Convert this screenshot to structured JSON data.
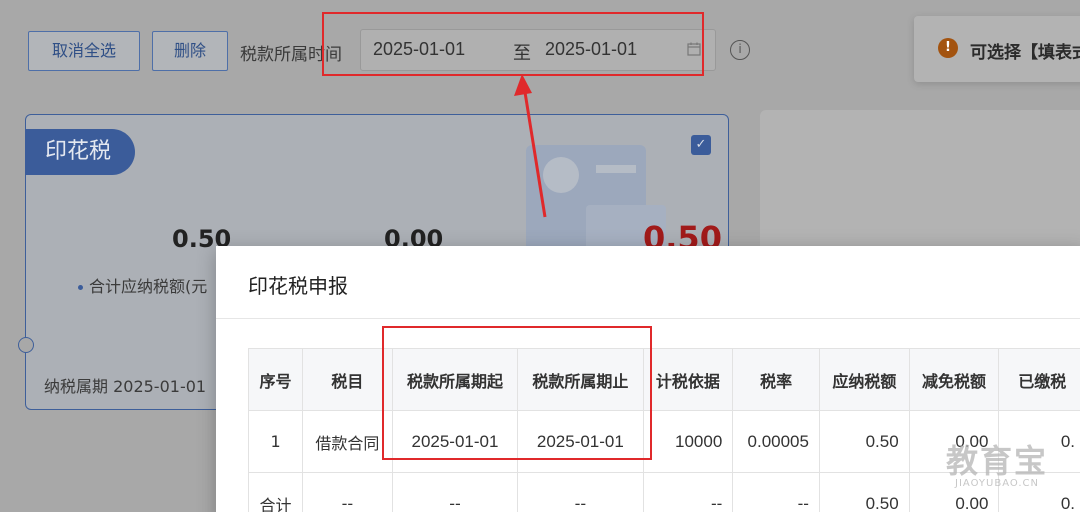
{
  "toolbar": {
    "cancel_select_label": "取消全选",
    "delete_label": "删除",
    "period_label": "税款所属时间",
    "date_start": "2025-01-01",
    "date_sep": "至",
    "date_end": "2025-01-01",
    "info_icon": "i"
  },
  "notice": {
    "icon": "!",
    "text": "可选择【填表式"
  },
  "card": {
    "tag": "印花税",
    "checked": "✓",
    "value1": "0.50",
    "value2": "0.00",
    "value3": "0.50",
    "label1": "合计应纳税额(元",
    "period": "纳税属期 2025-01-01"
  },
  "modal": {
    "title": "印花税申报",
    "columns": [
      "序号",
      "税目",
      "税款所属期起",
      "税款所属期止",
      "计税依据",
      "税率",
      "应纳税额",
      "减免税额",
      "已缴税"
    ],
    "rows": [
      [
        "1",
        "借款合同",
        "2025-01-01",
        "2025-01-01",
        "10000",
        "0.00005",
        "0.50",
        "0.00",
        "0."
      ],
      [
        "合计",
        "--",
        "--",
        "--",
        "--",
        "--",
        "0.50",
        "0.00",
        "0."
      ]
    ]
  },
  "watermark": {
    "cn": "教育宝",
    "en": "JIAOYUBAO.CN"
  },
  "colors": {
    "accent": "#3b5c9a",
    "highlight": "#e0292b",
    "tax_value": "#a11a1a"
  }
}
